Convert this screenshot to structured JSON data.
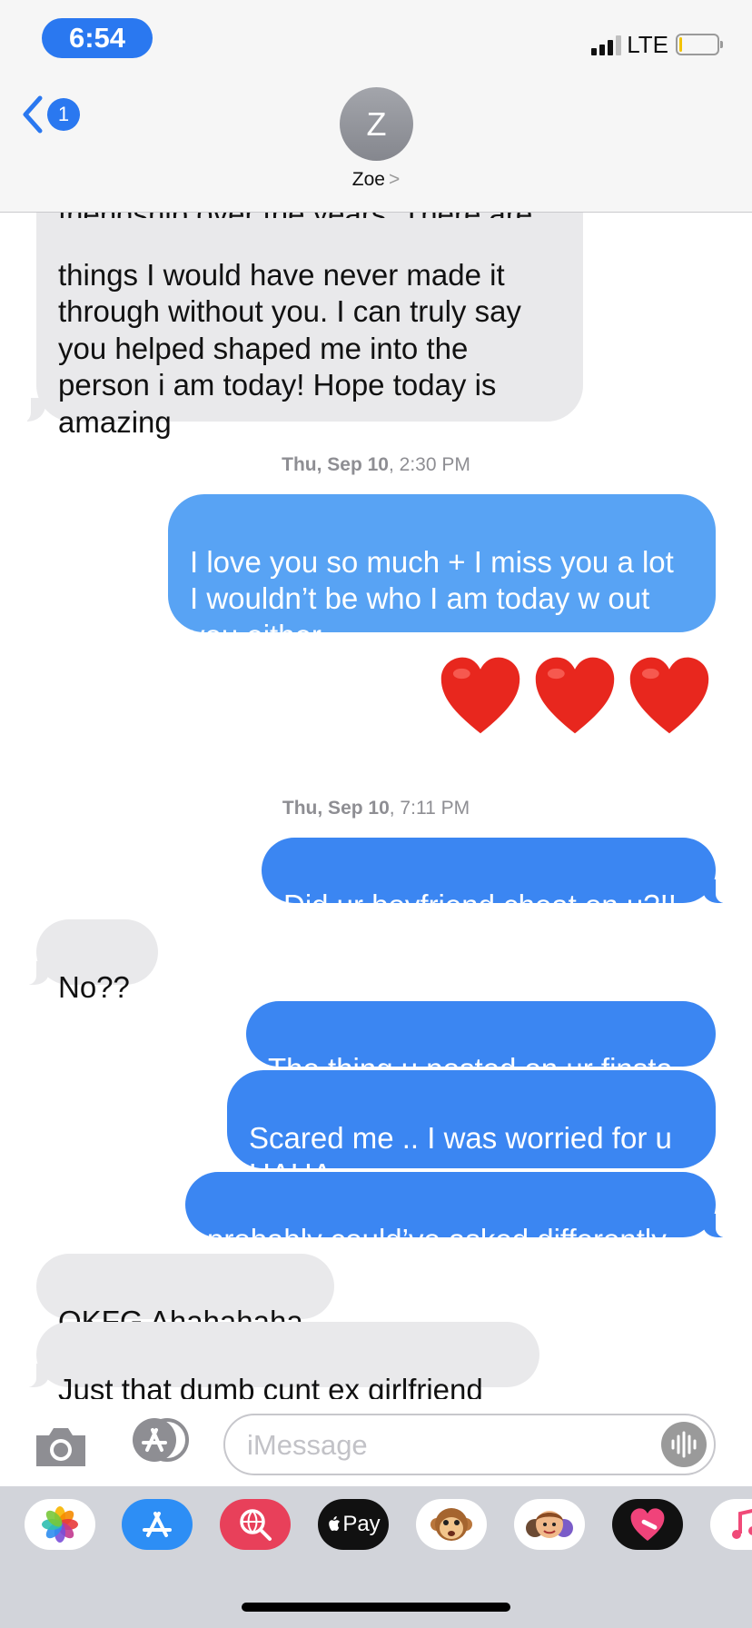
{
  "status_bar": {
    "time": "6:54",
    "network": "LTE"
  },
  "header": {
    "back_badge": "1",
    "avatar_initial": "Z",
    "contact_name": "Zoe",
    "contact_chevron": ">"
  },
  "messages": [
    {
      "from": "contact",
      "text": "friendship over the years. There are"
    },
    {
      "from": "contact",
      "text": "things I would have never made it\nthrough without you. I can truly say\nyou helped shaped me into the\nperson i am today! Hope today is\namazing"
    },
    {
      "timestamp_day": "Thu, Sep 10",
      "timestamp_time": ", 2:30 PM"
    },
    {
      "from": "me",
      "text": "I love you so much + I miss you a lot\nI wouldn’t be who I am today w out\nyou either"
    },
    {
      "from": "me",
      "emoji": "❤️❤️❤️"
    },
    {
      "timestamp_day": "Thu, Sep 10",
      "timestamp_time": ", 7:11 PM"
    },
    {
      "from": "me",
      "text": "Did ur boyfriend cheat on u?!!"
    },
    {
      "from": "contact",
      "text": "No??"
    },
    {
      "from": "me",
      "text": "The thing u posted on ur finsta"
    },
    {
      "from": "me",
      "text": "Scared me .. I was worried for u\nHAHA"
    },
    {
      "from": "me",
      "text": "probably could’ve asked differently"
    },
    {
      "from": "contact",
      "text": "OKFG Ahahahaha"
    },
    {
      "from": "contact",
      "text": "Just that dumb cunt ex girlfriend"
    }
  ],
  "composer": {
    "placeholder": "iMessage"
  },
  "app_drawer": [
    {
      "name": "photos-app-icon",
      "icon": "photos"
    },
    {
      "name": "app-store-app-icon",
      "icon": "app-store"
    },
    {
      "name": "web-images-app-icon",
      "icon": "globe-search"
    },
    {
      "name": "apple-pay-app-icon",
      "icon": "apple-pay",
      "label": "Pay"
    },
    {
      "name": "animoji-app-icon",
      "icon": "monkey"
    },
    {
      "name": "memoji-app-icon",
      "icon": "memoji"
    },
    {
      "name": "digital-touch-app-icon",
      "icon": "heart"
    },
    {
      "name": "music-app-icon",
      "icon": "music-note"
    }
  ],
  "colors": {
    "sent_bubble": "#3b86f2",
    "sent_bubble_light": "#58a3f4",
    "received_bubble": "#e9e9eb",
    "accent": "#2a78f0"
  }
}
